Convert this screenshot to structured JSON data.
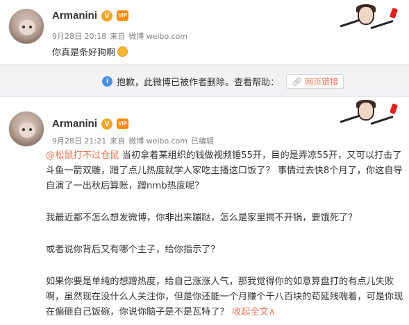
{
  "post1": {
    "author": "Armanini",
    "vip": "VIP",
    "time": "9月28日 20:18",
    "source_prefix": "来自",
    "source": "微博 weibo.com",
    "text": "你真是条好狗啊"
  },
  "deleted_notice": {
    "message": "抱歉，此微博已被作者删除。查看帮助：",
    "link_label": "网页链接"
  },
  "post2": {
    "author": "Armanini",
    "vip": "VIP",
    "time": "9月28日 21:21",
    "source_prefix": "来自",
    "source": "微博 weibo.com",
    "edited": "已编辑",
    "mention": "@松鼠打不过仓鼠",
    "p1_rest": " 当初拿着某组织的钱做视频锤55开，目的是弄凉55开，又可以打击了斗鱼一箭双雕，蹭了点儿热度就学人家吃主播这口饭了？ 事情过去快8个月了，你这自导自演了一出秋后算账，蹭nmb热度呢？",
    "p2": "我最近都不怎么想发微博，你非出来蹦跶，怎么是家里揭不开锅，要饿死了？",
    "p3": "或者说你背后又有哪个主子，给你指示了？",
    "p4": "如果你要是单纯的想蹭热度，给自己涨涨人气，那我觉得你的如意算盘打的有点儿失败啊，虽然现在没什么人关注你，但是你还能一个月赚个千八百块的苟延残喘着，可是你现在偏砸自己饭碗，你说你脑子是不是瓦特了？",
    "expand_label": "收起全文",
    "expand_icon": "chevron-up-icon"
  },
  "colors": {
    "link": "#eb7350",
    "muted": "#808080",
    "notice_bg": "#f2f2f5",
    "verify": "#f5a623"
  }
}
